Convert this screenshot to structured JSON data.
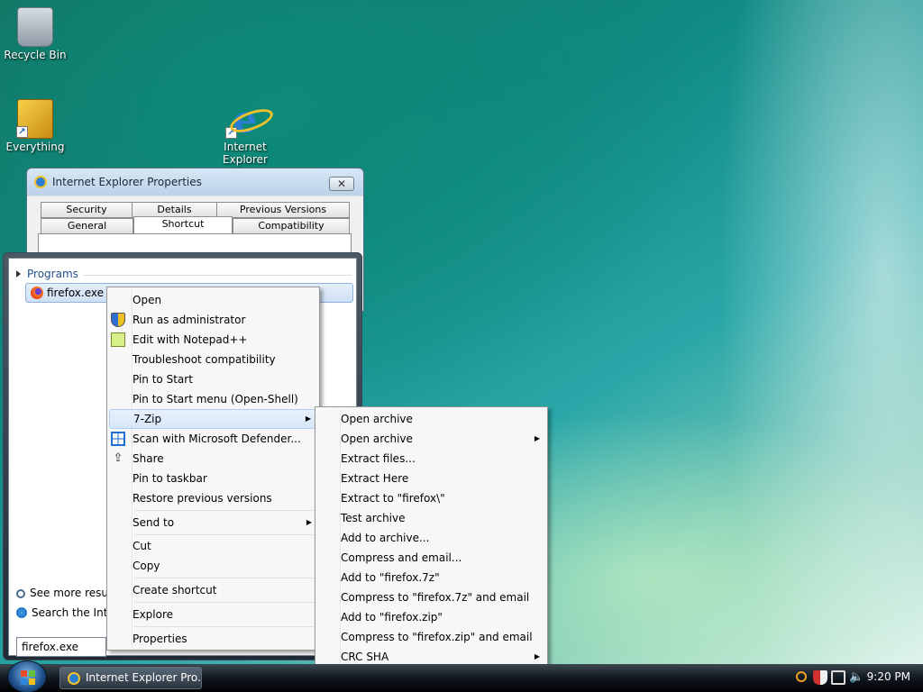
{
  "desktop": {
    "icons": [
      {
        "label": "Recycle Bin",
        "icon": "recycle-bin-icon"
      },
      {
        "label": "Everything",
        "icon": "everything-icon"
      },
      {
        "label": "Internet Explorer",
        "icon": "internet-explorer-icon"
      }
    ]
  },
  "dialog": {
    "title": "Internet Explorer Properties",
    "close": "✕",
    "tabs_row1": [
      "Security",
      "Details",
      "Previous Versions"
    ],
    "tabs_row2": [
      "General",
      "Shortcut",
      "Compatibility"
    ],
    "active_tab": "Shortcut"
  },
  "start_menu": {
    "group_header": "Programs",
    "result": "firefox.exe",
    "see_more": "See more results",
    "search_internet": "Search the Internet",
    "search_value": "firefox.exe"
  },
  "context_menu": {
    "items": [
      "Open",
      "Run as administrator",
      "Edit with Notepad++",
      "Troubleshoot compatibility",
      "Pin to Start",
      "Pin to Start menu (Open-Shell)",
      "7-Zip",
      "Scan with Microsoft Defender...",
      "Share",
      "Pin to taskbar",
      "Restore previous versions",
      "Send to",
      "Cut",
      "Copy",
      "Create shortcut",
      "Explore",
      "Properties"
    ],
    "submenu_arrow": "▶"
  },
  "zip_menu": {
    "items": [
      "Open archive",
      "Open archive",
      "Extract files...",
      "Extract Here",
      "Extract to \"firefox\\\"",
      "Test archive",
      "Add to archive...",
      "Compress and email...",
      "Add to \"firefox.7z\"",
      "Compress to \"firefox.7z\" and email",
      "Add to \"firefox.zip\"",
      "Compress to \"firefox.zip\" and email",
      "CRC SHA"
    ]
  },
  "taskbar": {
    "window_button": "Internet Explorer Pro...",
    "clock": "9:20 PM"
  }
}
